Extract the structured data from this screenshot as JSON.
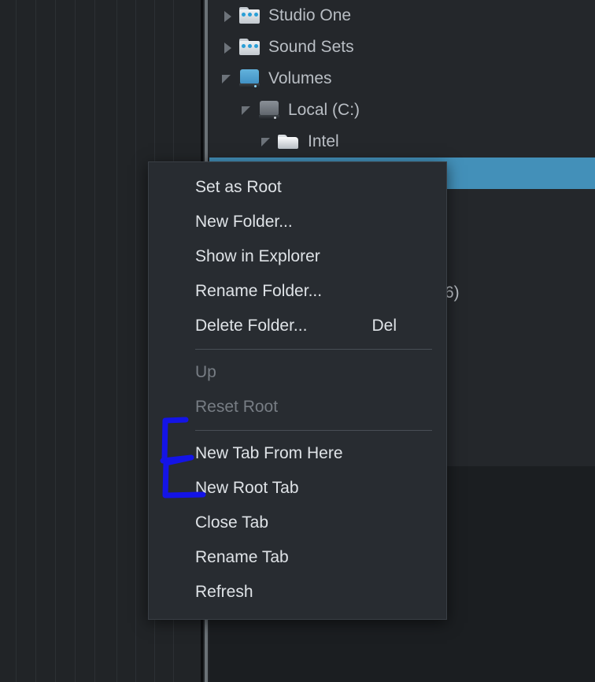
{
  "app": {
    "accent_selection": "#4390b9",
    "menu_background": "#282c31",
    "panel_background": "#24272b",
    "annotation_color": "#1414e6"
  },
  "browser_tree": {
    "items": [
      {
        "label": "Studio One",
        "depth": 0,
        "twisty": "closed",
        "icon": "dot-folder-icon",
        "selected": false
      },
      {
        "label": "Sound Sets",
        "depth": 0,
        "twisty": "closed",
        "icon": "dot-folder-icon",
        "selected": false
      },
      {
        "label": "Volumes",
        "depth": 0,
        "twisty": "open",
        "icon": "drive-blue-icon",
        "selected": false
      },
      {
        "label": "Local (C:)",
        "depth": 1,
        "twisty": "open",
        "icon": "drive-gray-icon",
        "selected": false
      },
      {
        "label": "Intel",
        "depth": 2,
        "twisty": "open",
        "icon": "folder-icon",
        "selected": false
      },
      {
        "label": "",
        "depth": 3,
        "twisty": "open",
        "icon": "folder-icon",
        "selected": true
      }
    ]
  },
  "partial_text": {
    "clipped_label": "6)"
  },
  "context_menu": {
    "groups": [
      {
        "items": [
          {
            "label": "Set as Root",
            "shortcut": "",
            "enabled": true
          },
          {
            "label": "New Folder...",
            "shortcut": "",
            "enabled": true
          },
          {
            "label": "Show in Explorer",
            "shortcut": "",
            "enabled": true
          },
          {
            "label": "Rename Folder...",
            "shortcut": "",
            "enabled": true
          },
          {
            "label": "Delete Folder...",
            "shortcut": "Del",
            "enabled": true
          }
        ]
      },
      {
        "items": [
          {
            "label": "Up",
            "shortcut": "",
            "enabled": false
          },
          {
            "label": "Reset Root",
            "shortcut": "",
            "enabled": false
          }
        ]
      },
      {
        "items": [
          {
            "label": "New Tab From Here",
            "shortcut": "",
            "enabled": true
          },
          {
            "label": "New Root Tab",
            "shortcut": "",
            "enabled": true
          },
          {
            "label": "Close Tab",
            "shortcut": "",
            "enabled": true
          },
          {
            "label": "Rename Tab",
            "shortcut": "",
            "enabled": true
          },
          {
            "label": "Refresh",
            "shortcut": "",
            "enabled": true
          }
        ]
      }
    ]
  },
  "annotation": {
    "shape": "hand-drawn-bracket",
    "targets": [
      "New Tab From Here",
      "New Root Tab"
    ]
  },
  "timeline": {
    "stripe_positions": [
      20,
      45,
      70,
      95,
      120,
      148,
      172,
      196,
      220
    ]
  }
}
